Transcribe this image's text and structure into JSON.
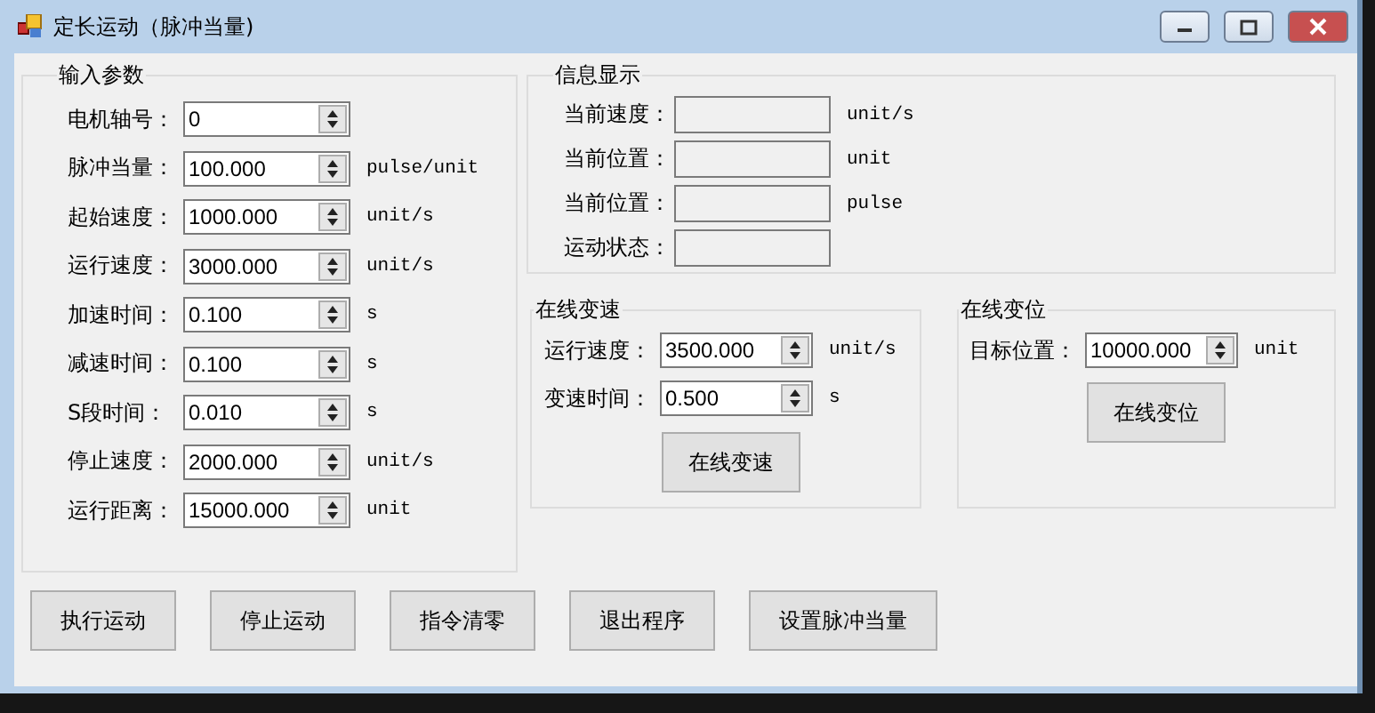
{
  "window": {
    "title": "定长运动（脉冲当量)"
  },
  "input_params": {
    "title": "输入参数",
    "rows": [
      {
        "label": "电机轴号：",
        "value": "0"
      },
      {
        "label": "脉冲当量：",
        "value": "100.000",
        "unit": "pulse/unit"
      },
      {
        "label": "起始速度：",
        "value": "1000.000",
        "unit": "unit/s"
      },
      {
        "label": "运行速度：",
        "value": "3000.000",
        "unit": "unit/s"
      },
      {
        "label": "加速时间：",
        "value": "0.100",
        "unit": "s"
      },
      {
        "label": "减速时间：",
        "value": "0.100",
        "unit": "s"
      },
      {
        "label": "S段时间：",
        "value": "0.010",
        "unit": "s"
      },
      {
        "label": "停止速度：",
        "value": "2000.000",
        "unit": "unit/s"
      },
      {
        "label": "运行距离：",
        "value": "15000.000",
        "unit": "unit"
      }
    ]
  },
  "info": {
    "title": "信息显示",
    "rows": [
      {
        "label": "当前速度：",
        "unit": "unit/s"
      },
      {
        "label": "当前位置：",
        "unit": "unit"
      },
      {
        "label": "当前位置：",
        "unit": "pulse"
      },
      {
        "label": "运动状态："
      }
    ]
  },
  "online_speed": {
    "title": "在线变速",
    "rows": [
      {
        "label": "运行速度：",
        "value": "3500.000",
        "unit": "unit/s"
      },
      {
        "label": "变速时间：",
        "value": "0.500",
        "unit": "s"
      }
    ],
    "button": "在线变速"
  },
  "online_position": {
    "title": "在线变位",
    "rows": [
      {
        "label": "目标位置：",
        "value": "10000.000",
        "unit": "unit"
      }
    ],
    "button": "在线变位"
  },
  "buttons": [
    "执行运动",
    "停止运动",
    "指令清零",
    "退出程序",
    "设置脉冲当量"
  ]
}
